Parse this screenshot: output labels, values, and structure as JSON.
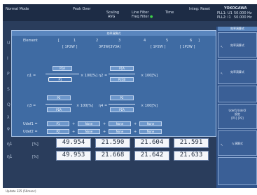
{
  "status_bar": {
    "mode": "Normal Mode",
    "peak_over": "Peak Over",
    "scaling": "Scaling",
    "avg": "AVG",
    "line_filter": "Line Filter",
    "freq_filter": "Freq Filter",
    "time": "Time",
    "integ": "Integ: Reset",
    "brand": "YOKOGAWA",
    "pll1": "PLL1: U1",
    "pll1_val": "50.000 Hz",
    "pll2": "PLL2: I1",
    "pll2_val": "50.000 Hz"
  },
  "dialog": {
    "title": "効率演算式",
    "element_label": "Element",
    "element_cols": [
      "1",
      "2",
      "3",
      "4",
      "5",
      "6"
    ],
    "wiring_label": "[ 1P2W ]",
    "wiring_mid": "3P3W(3V3A)",
    "wiring_right1": "[ 1P2W ]",
    "wiring_right2": "[ 1P2W ]",
    "eta1": {
      "label": "η1 =",
      "num": "PΣA",
      "den": "P1",
      "unit": "× 100[%]"
    },
    "eta2": {
      "label": "η2 =",
      "num": "PΣA",
      "den": "P2ΣB",
      "unit": "× 100[%]"
    },
    "eta3": {
      "label": "η3 =",
      "num": "P2",
      "den": "PΣA",
      "unit": "× 100[%]"
    },
    "eta4": {
      "label": "η4 =",
      "num": "P2",
      "den": "PΣA",
      "unit": "× 100[%]"
    },
    "udef1": {
      "label": "Udef1 =",
      "terms": [
        "P1",
        "None",
        "None",
        "None"
      ]
    },
    "udef2": {
      "label": "Udef2 =",
      "terms": [
        "P2",
        "None",
        "None",
        "None"
      ]
    },
    "plus": "+"
  },
  "left_letters": [
    "U",
    "I",
    "P",
    "S",
    "Q",
    "λ",
    "φ"
  ],
  "measurements": [
    {
      "label": "η1",
      "tag": "[%]",
      "values": [
        "49.954",
        "21.590",
        "21.604",
        "21.591"
      ]
    },
    {
      "label": "η1",
      "tag": "[%]",
      "values": [
        "49.953",
        "21.668",
        "21.642",
        "21.633"
      ]
    }
  ],
  "softkeys": {
    "header": "効率演算式",
    "k1": "効率演算式",
    "k2": "効率演算式",
    "k3_line1": "Udef1/Udef2",
    "k3_line2": "設定",
    "k3_value": "[P1]  [P2]",
    "k4": "η 演算式"
  },
  "footer": {
    "text": "Update  325  (50msec)"
  }
}
